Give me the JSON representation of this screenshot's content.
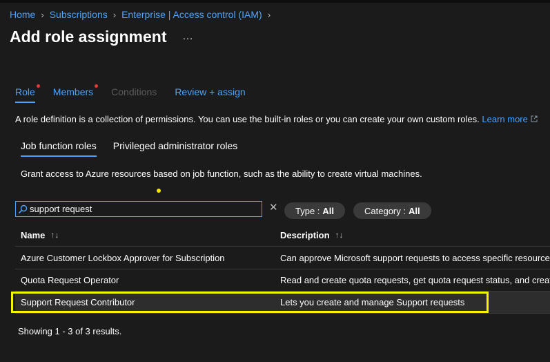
{
  "breadcrumb": [
    "Home",
    "Subscriptions",
    "Enterprise | Access control (IAM)"
  ],
  "page": {
    "title": "Add role assignment",
    "more": "…"
  },
  "tabs": [
    {
      "label": "Role"
    },
    {
      "label": "Members"
    },
    {
      "label": "Conditions"
    },
    {
      "label": "Review + assign"
    }
  ],
  "description": {
    "text": "A role definition is a collection of permissions. You can use the built-in roles or you can create your own custom roles.",
    "link": "Learn more"
  },
  "subtabs": [
    "Job function roles",
    "Privileged administrator roles"
  ],
  "grant_text": "Grant access to Azure resources based on job function, such as the ability to create virtual machines.",
  "search": {
    "value": "support request"
  },
  "filters": {
    "type_label": "Type :",
    "type_value": "All",
    "category_label": "Category :",
    "category_value": "All"
  },
  "table": {
    "columns": [
      "Name",
      "Description"
    ],
    "rows": [
      {
        "name": "Azure Customer Lockbox Approver for Subscription",
        "description": "Can approve Microsoft support requests to access specific resources"
      },
      {
        "name": "Quota Request Operator",
        "description": "Read and create quota requests, get quota request status, and create"
      },
      {
        "name": "Support Request Contributor",
        "description": "Lets you create and manage Support requests"
      }
    ]
  },
  "status": "Showing 1 - 3 of 3 results.",
  "colors": {
    "accent": "#4aa3ff",
    "highlight": "#f5f500",
    "required_dot": "#e23b3b"
  }
}
